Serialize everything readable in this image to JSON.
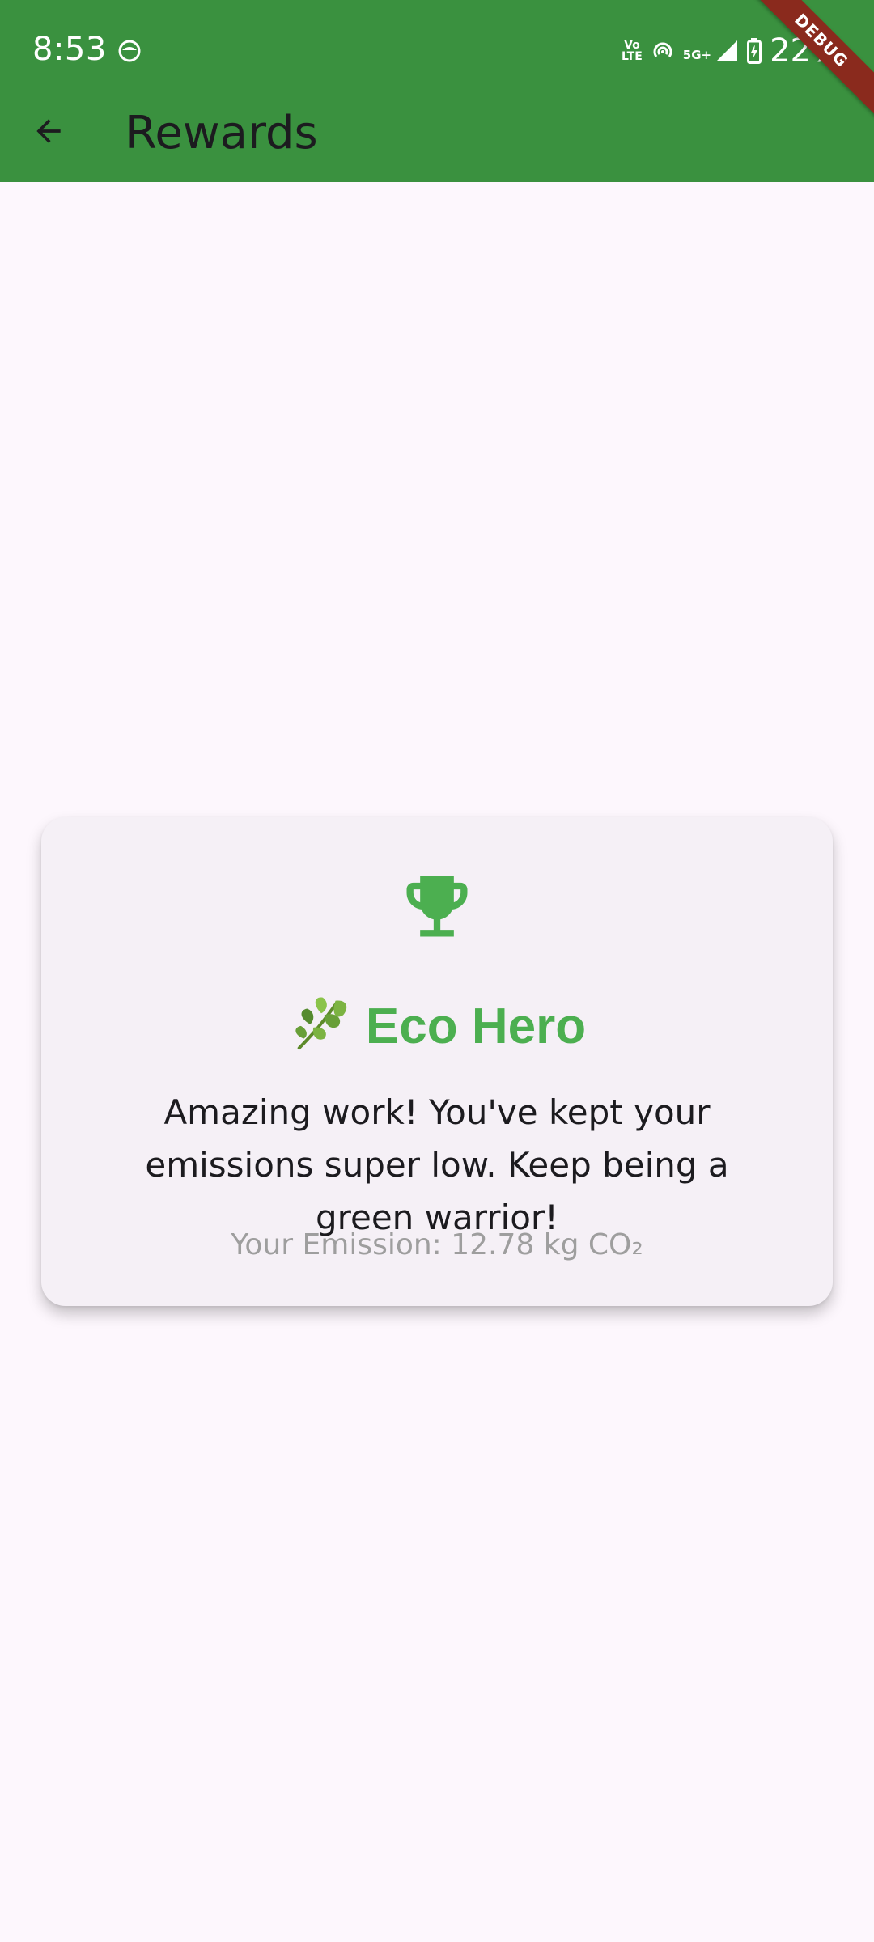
{
  "status_bar": {
    "time": "8:53",
    "network_type": "5G+",
    "volte_label": "Vo\nLTE",
    "battery_percent": "22%",
    "icons": [
      "notification-icon",
      "volte-icon",
      "hotspot-icon",
      "signal-icon",
      "battery-charging-icon"
    ]
  },
  "debug_banner": "DEBUG",
  "app_bar": {
    "title": "Rewards",
    "back_icon": "arrow-back-icon",
    "color": "#3a913f"
  },
  "reward_card": {
    "trophy_icon": "trophy-icon",
    "leaf_icon": "herb-leaf-emoji",
    "badge_title": "Eco Hero",
    "message": "Amazing work! You've kept your emissions super low. Keep being a green warrior!",
    "emission_text": "Your Emission: 12.78 kg CO₂",
    "accent_color": "#4caf50"
  }
}
